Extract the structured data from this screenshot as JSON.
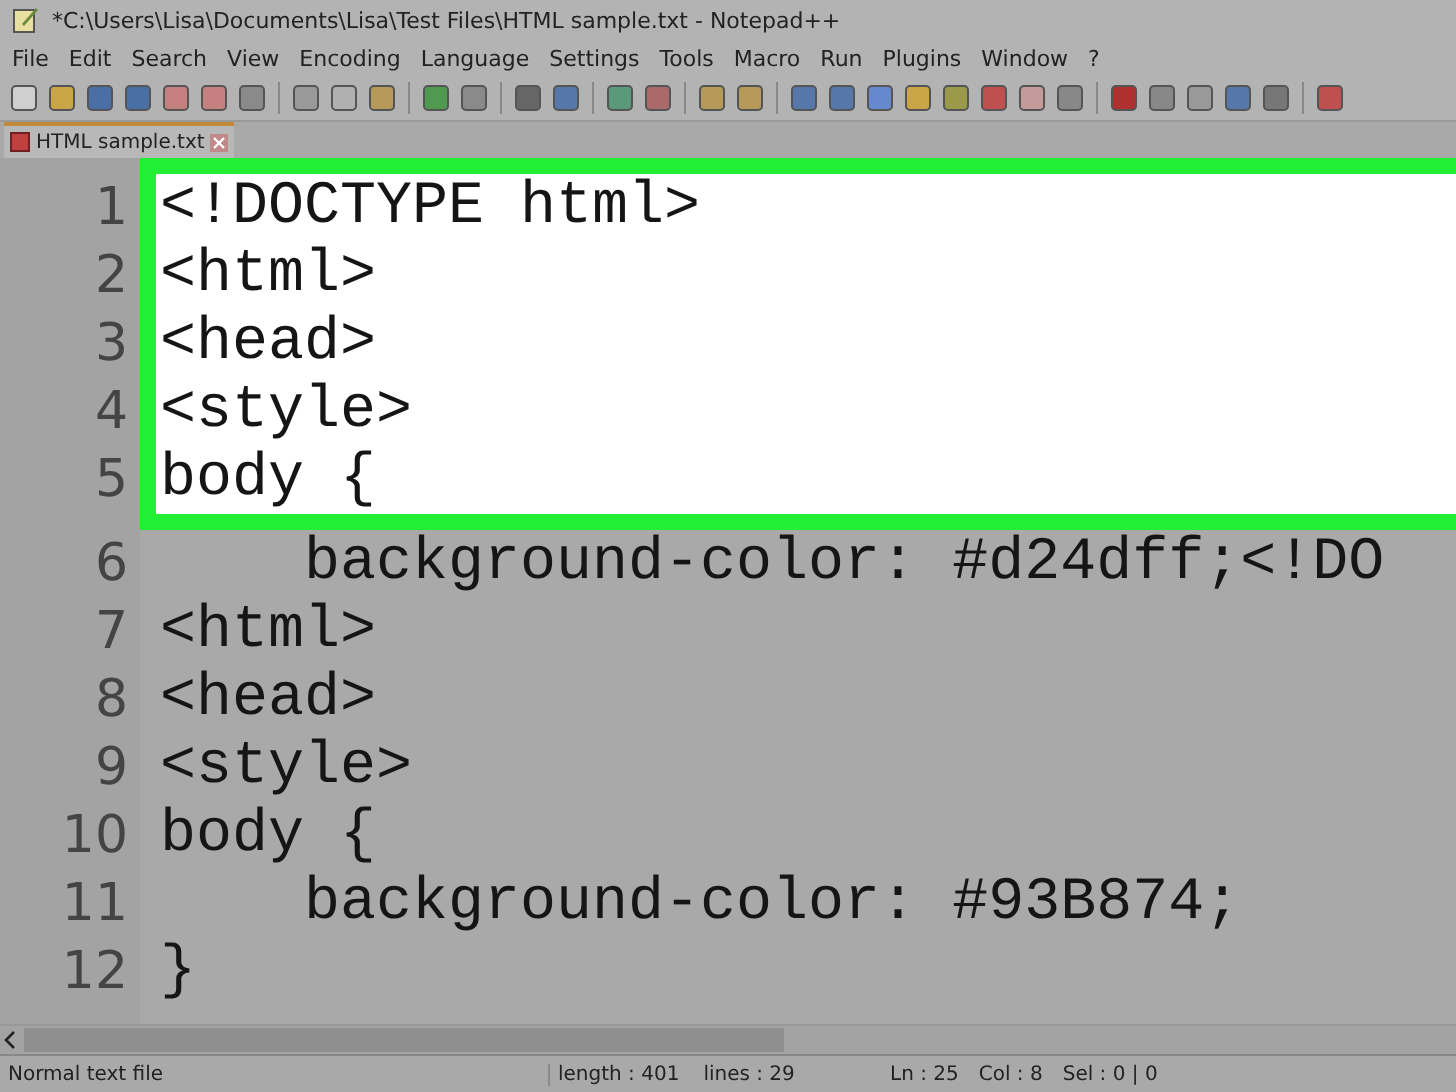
{
  "window": {
    "title": "*C:\\Users\\Lisa\\Documents\\Lisa\\Test Files\\HTML sample.txt - Notepad++"
  },
  "menu": [
    {
      "label": "File"
    },
    {
      "label": "Edit"
    },
    {
      "label": "Search"
    },
    {
      "label": "View"
    },
    {
      "label": "Encoding"
    },
    {
      "label": "Language"
    },
    {
      "label": "Settings"
    },
    {
      "label": "Tools"
    },
    {
      "label": "Macro"
    },
    {
      "label": "Run"
    },
    {
      "label": "Plugins"
    },
    {
      "label": "Window"
    },
    {
      "label": "?"
    }
  ],
  "tabs": [
    {
      "label": "HTML sample.txt",
      "selected": true
    }
  ],
  "editor": {
    "lines": [
      {
        "number": "1",
        "text": "<!DOCTYPE html>",
        "highlighted": true
      },
      {
        "number": "2",
        "text": "<html>",
        "highlighted": true
      },
      {
        "number": "3",
        "text": "<head>",
        "highlighted": true
      },
      {
        "number": "4",
        "text": "<style>",
        "highlighted": true
      },
      {
        "number": "5",
        "text": "body {",
        "highlighted": true
      },
      {
        "number": "6",
        "text": "    background-color: #d24dff;<!DO",
        "highlighted": false
      },
      {
        "number": "7",
        "text": "<html>",
        "highlighted": false
      },
      {
        "number": "8",
        "text": "<head>",
        "highlighted": false
      },
      {
        "number": "9",
        "text": "<style>",
        "highlighted": false
      },
      {
        "number": "10",
        "text": "body {",
        "highlighted": false
      },
      {
        "number": "11",
        "text": "    background-color: #93B874;",
        "highlighted": false
      },
      {
        "number": "12",
        "text": "}",
        "highlighted": false
      }
    ]
  },
  "status_bar": {
    "file_type": "Normal text file",
    "length": "length : 401",
    "lines": "lines : 29",
    "ln": "Ln : 25",
    "col": "Col : 8",
    "sel": "Sel : 0 | 0"
  }
}
